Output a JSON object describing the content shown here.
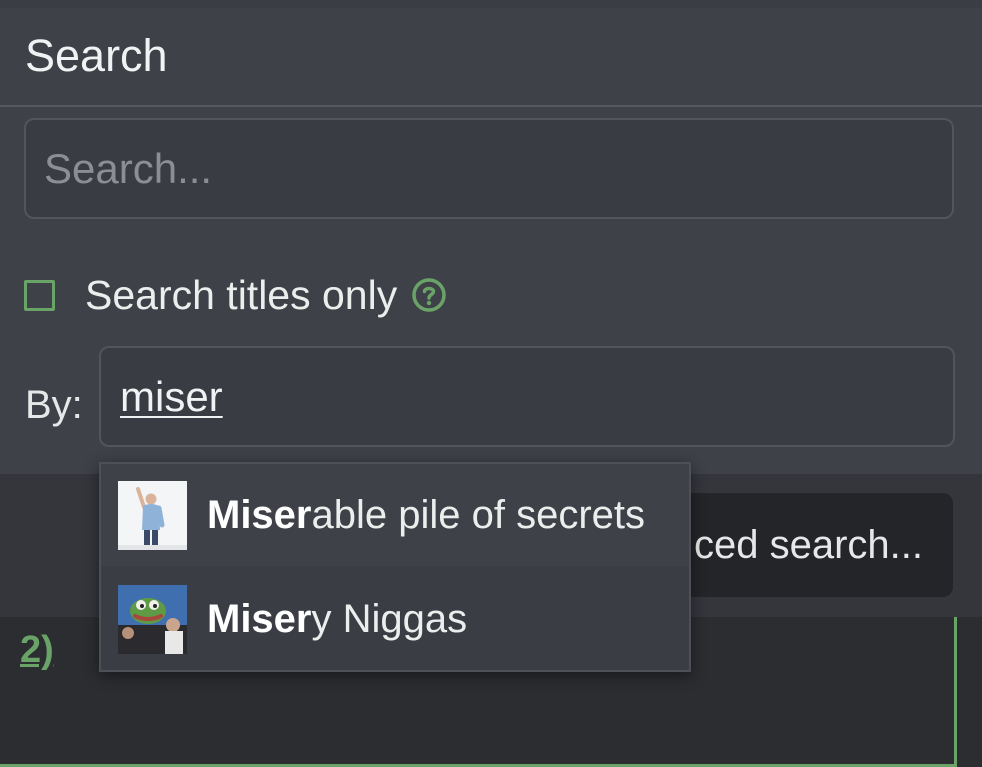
{
  "search_panel": {
    "title": "Search",
    "search_input": {
      "placeholder": "Search...",
      "value": ""
    },
    "titles_only": {
      "label": "Search titles only",
      "checked": false,
      "help_icon": "question-circle-icon"
    },
    "by": {
      "label": "By:",
      "value": "miser"
    },
    "advanced_button": {
      "label": "Advanced search...",
      "visible_label": "ced search..."
    }
  },
  "autocomplete": {
    "items": [
      {
        "match": "Miser",
        "rest": "able pile of secrets",
        "avatar": "man-photo-avatar",
        "highlighted": true
      },
      {
        "match": "Miser",
        "rest": "y Niggas",
        "avatar": "frog-meme-avatar",
        "highlighted": false
      }
    ]
  },
  "background": {
    "quote_number": "2)"
  },
  "colors": {
    "accent": "#6aa367",
    "panel": "#3e4147",
    "background": "#2b2d31"
  }
}
